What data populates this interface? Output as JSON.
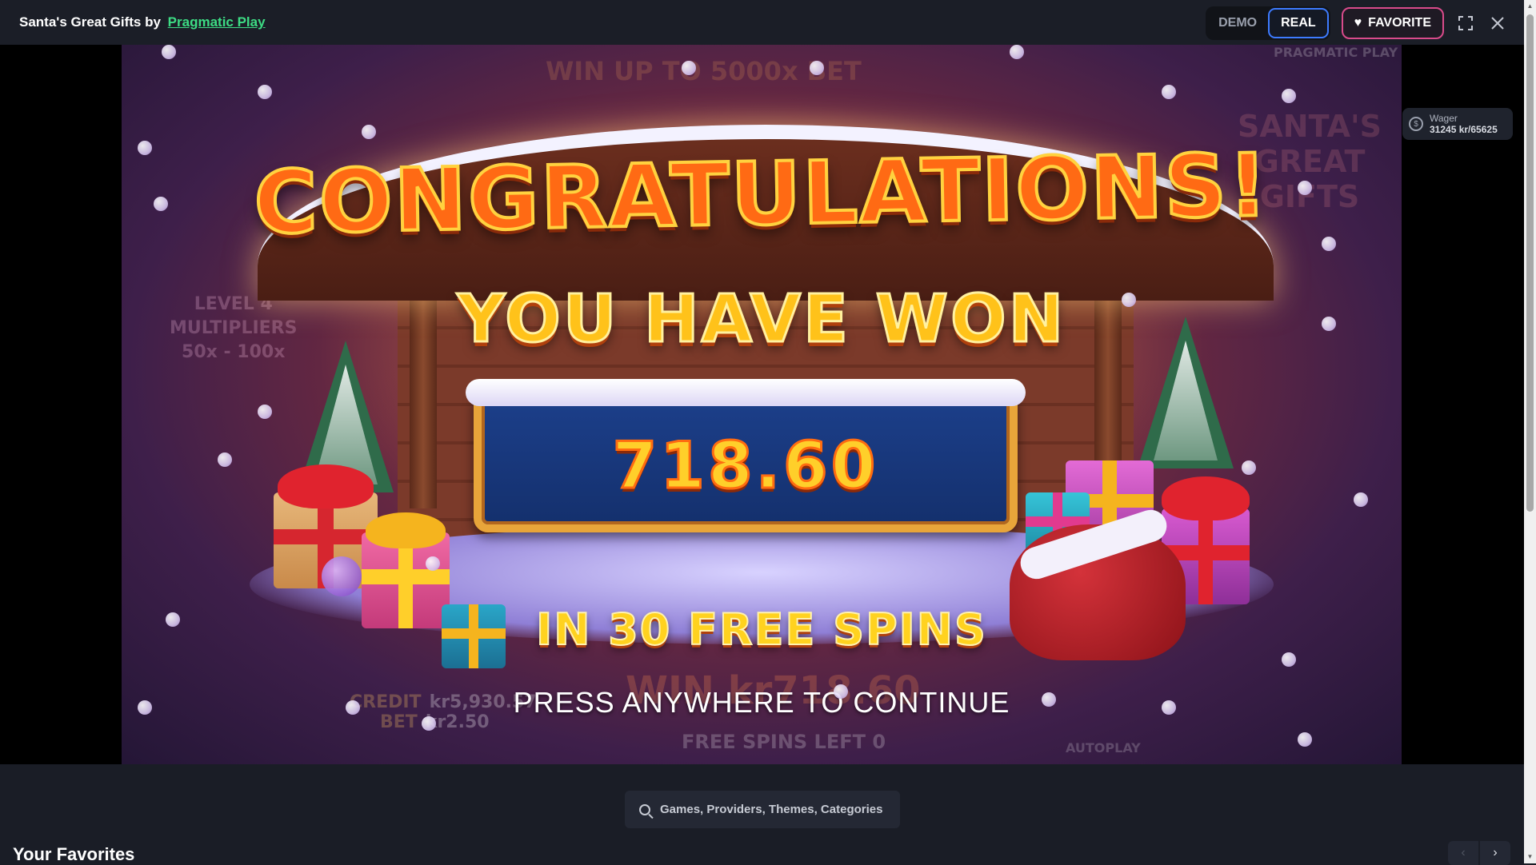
{
  "topbar": {
    "title_prefix": "Santa's Great Gifts by",
    "provider_link": "Pragmatic Play",
    "mode_demo": "DEMO",
    "mode_real": "REAL",
    "favorite_label": "FAVORITE",
    "fullscreen_icon": "fullscreen-icon",
    "close_icon": "close-icon"
  },
  "game": {
    "congrats": "CONGRATULATIONS!",
    "you_have_won": "YOU HAVE WON",
    "amount": "718.60",
    "free_spins_text": "IN 30 FREE SPINS",
    "press_continue": "PRESS ANYWHERE TO CONTINUE",
    "bg_promo": "WIN UP TO 5000x BET",
    "bg_provider": "PRAGMATIC PLAY",
    "bg_logo": "SANTA'S GREAT GIFTS",
    "bg_level_label": "LEVEL 4",
    "bg_multiplier_label": "MULTIPLIERS",
    "bg_multiplier_range": "50x - 100x",
    "credit_label": "CREDIT",
    "credit_value": "kr5,930.57",
    "bet_label": "BET",
    "bet_value": "kr2.50",
    "win_label": "WIN kr718.60",
    "free_spins_left": "FREE SPINS LEFT 0",
    "autoplay": "AUTOPLAY"
  },
  "wager": {
    "label": "Wager",
    "value": "31245 kr/65625"
  },
  "search": {
    "placeholder": "Games, Providers, Themes, Categories"
  },
  "favorites": {
    "heading": "Your Favorites"
  },
  "colors": {
    "accent_green": "#3ddc84",
    "real_border": "#3d7bff",
    "favorite_border": "#d94b8b"
  }
}
